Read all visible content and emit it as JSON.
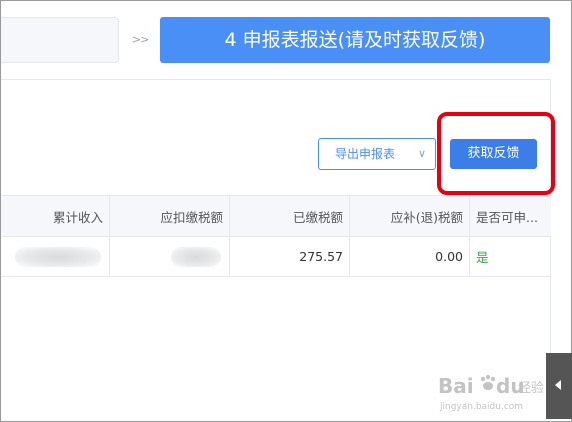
{
  "steps": {
    "separator": ">>",
    "current_label": "4 申报表报送(请及时获取反馈)"
  },
  "toolbar": {
    "export_label": "导出申报表",
    "feedback_label": "获取反馈"
  },
  "table": {
    "headers": [
      "累计收入",
      "应扣缴税额",
      "已缴税额",
      "应补(退)税额",
      "是否可申..."
    ],
    "rows": [
      {
        "cumulative_income": "",
        "tax_withheld": "",
        "tax_paid": "275.57",
        "tax_due_refund": "0.00",
        "can_declare": "是"
      }
    ]
  },
  "watermark": {
    "brand": "Bai",
    "brand2": "du",
    "suffix": "经验",
    "url": "jingyan.baidu.com"
  },
  "colors": {
    "primary": "#4a8ff5",
    "button": "#3b7ee8",
    "highlight": "#e60012",
    "yes": "#3ca44a"
  }
}
